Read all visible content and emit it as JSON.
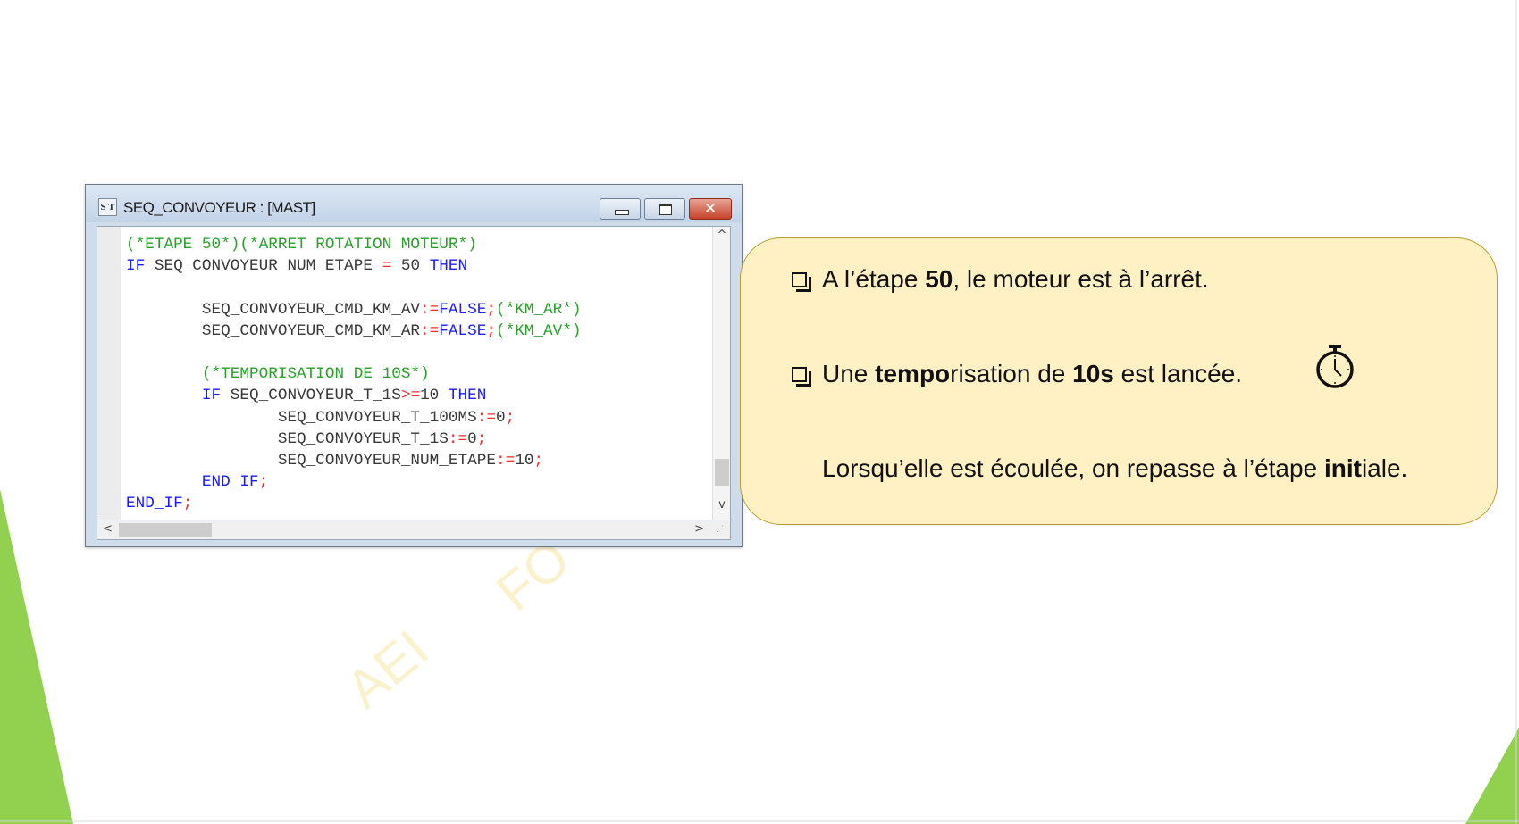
{
  "window": {
    "icon_label": "S T",
    "title": "SEQ_CONVOYEUR : [MAST]"
  },
  "code_lines": [
    [
      {
        "t": "(*ETAPE 50*)(*ARRET ROTATION MOTEUR*)",
        "c": "comment"
      }
    ],
    [
      {
        "t": "IF",
        "c": "kw"
      },
      {
        "t": " SEQ_CONVOYEUR_NUM_ETAPE ",
        "c": "id"
      },
      {
        "t": "=",
        "c": "op"
      },
      {
        "t": " 50 ",
        "c": "id"
      },
      {
        "t": "THEN",
        "c": "kw"
      }
    ],
    [],
    [
      {
        "t": "        SEQ_CONVOYEUR_CMD_KM_AV",
        "c": "id"
      },
      {
        "t": ":=",
        "c": "op"
      },
      {
        "t": "FALSE",
        "c": "kw"
      },
      {
        "t": ";",
        "c": "op"
      },
      {
        "t": "(*KM_AR*)",
        "c": "comment"
      }
    ],
    [
      {
        "t": "        SEQ_CONVOYEUR_CMD_KM_AR",
        "c": "id"
      },
      {
        "t": ":=",
        "c": "op"
      },
      {
        "t": "FALSE",
        "c": "kw"
      },
      {
        "t": ";",
        "c": "op"
      },
      {
        "t": "(*KM_AV*)",
        "c": "comment"
      }
    ],
    [],
    [
      {
        "t": "        (*TEMPORISATION DE 10S*)",
        "c": "comment"
      }
    ],
    [
      {
        "t": "        ",
        "c": "id"
      },
      {
        "t": "IF",
        "c": "kw"
      },
      {
        "t": " SEQ_CONVOYEUR_T_1S",
        "c": "id"
      },
      {
        "t": ">=",
        "c": "op"
      },
      {
        "t": "10 ",
        "c": "id"
      },
      {
        "t": "THEN",
        "c": "kw"
      }
    ],
    [
      {
        "t": "                SEQ_CONVOYEUR_T_100MS",
        "c": "id"
      },
      {
        "t": ":=",
        "c": "op"
      },
      {
        "t": "0",
        "c": "id"
      },
      {
        "t": ";",
        "c": "op"
      }
    ],
    [
      {
        "t": "                SEQ_CONVOYEUR_T_1S",
        "c": "id"
      },
      {
        "t": ":=",
        "c": "op"
      },
      {
        "t": "0",
        "c": "id"
      },
      {
        "t": ";",
        "c": "op"
      }
    ],
    [
      {
        "t": "                SEQ_CONVOYEUR_NUM_ETAPE",
        "c": "id"
      },
      {
        "t": ":=",
        "c": "op"
      },
      {
        "t": "10",
        "c": "id"
      },
      {
        "t": ";",
        "c": "op"
      }
    ],
    [
      {
        "t": "        ",
        "c": "id"
      },
      {
        "t": "END_IF",
        "c": "kw"
      },
      {
        "t": ";",
        "c": "op"
      }
    ],
    [
      {
        "t": "END_IF",
        "c": "kw"
      },
      {
        "t": ";",
        "c": "op"
      }
    ]
  ],
  "colors": {
    "comment": "#2aa02a",
    "keyword": "#1a1aff",
    "operator": "#ff2a2a",
    "callout_bg": "#fff1c4",
    "callout_border": "#b89c2c",
    "slide_triangle": "#92d050"
  },
  "callout": {
    "line1": {
      "a": "A l’étape ",
      "b": "50",
      "c": ", le moteur est à l’arrêt."
    },
    "line2": {
      "a": "Une ",
      "b": "tempo",
      "c": "risation de ",
      "d": "10s",
      "e": " est lancée."
    },
    "line3": {
      "a": "Lorsqu’elle est écoulée, on repasse à l’étape ",
      "b": "init",
      "c": "iale."
    },
    "timer_icon": "stopwatch-icon",
    "bullet_icon": "checkbox-bullet-icon"
  },
  "watermark": {
    "text_1": "AEI",
    "text_2": "FO"
  }
}
